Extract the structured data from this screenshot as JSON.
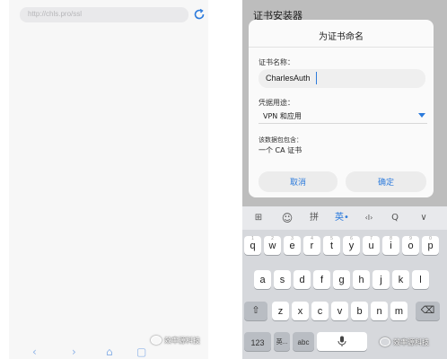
{
  "left_screen": {
    "url_text": "http://chls.pro/ssl",
    "watermark": "效率源科技"
  },
  "right_screen": {
    "installer_title": "证书安装器",
    "dialog": {
      "title": "为证书命名",
      "name_label": "证书名称：",
      "name_value": "CharlesAuth",
      "usage_label": "凭据用途：",
      "usage_value": "VPN 和应用",
      "contains_label": "该数据包包含：",
      "contains_value": "一个 CA 证书",
      "cancel_label": "取消",
      "ok_label": "确定"
    },
    "keyboard": {
      "toolbar": {
        "grid": "⊞",
        "emoji": "☺",
        "pinyin": "拼",
        "lang": "英•",
        "cursor": "‹I›",
        "search": "Q",
        "collapse": "∨"
      },
      "row1": [
        {
          "char": "q",
          "digit": "1"
        },
        {
          "char": "w",
          "digit": "2"
        },
        {
          "char": "e",
          "digit": "3"
        },
        {
          "char": "r",
          "digit": "4"
        },
        {
          "char": "t",
          "digit": "5"
        },
        {
          "char": "y",
          "digit": "6"
        },
        {
          "char": "u",
          "digit": "7"
        },
        {
          "char": "i",
          "digit": "8"
        },
        {
          "char": "o",
          "digit": "9"
        },
        {
          "char": "p",
          "digit": "0"
        }
      ],
      "row2": [
        "a",
        "s",
        "d",
        "f",
        "g",
        "h",
        "j",
        "k",
        "l"
      ],
      "row3": [
        "z",
        "x",
        "c",
        "v",
        "b",
        "n",
        "m"
      ],
      "shift": "⇧",
      "backspace": "⌫",
      "num_key": "123",
      "cn_key": "英...",
      "abc_key": "abc",
      "space_icon": "mic-icon"
    },
    "watermark": "效率源科技"
  },
  "colors": {
    "accent": "#2d7bdc",
    "keyboard_bg": "#d6d8dc",
    "dim_bg": "#bdbdbd"
  }
}
